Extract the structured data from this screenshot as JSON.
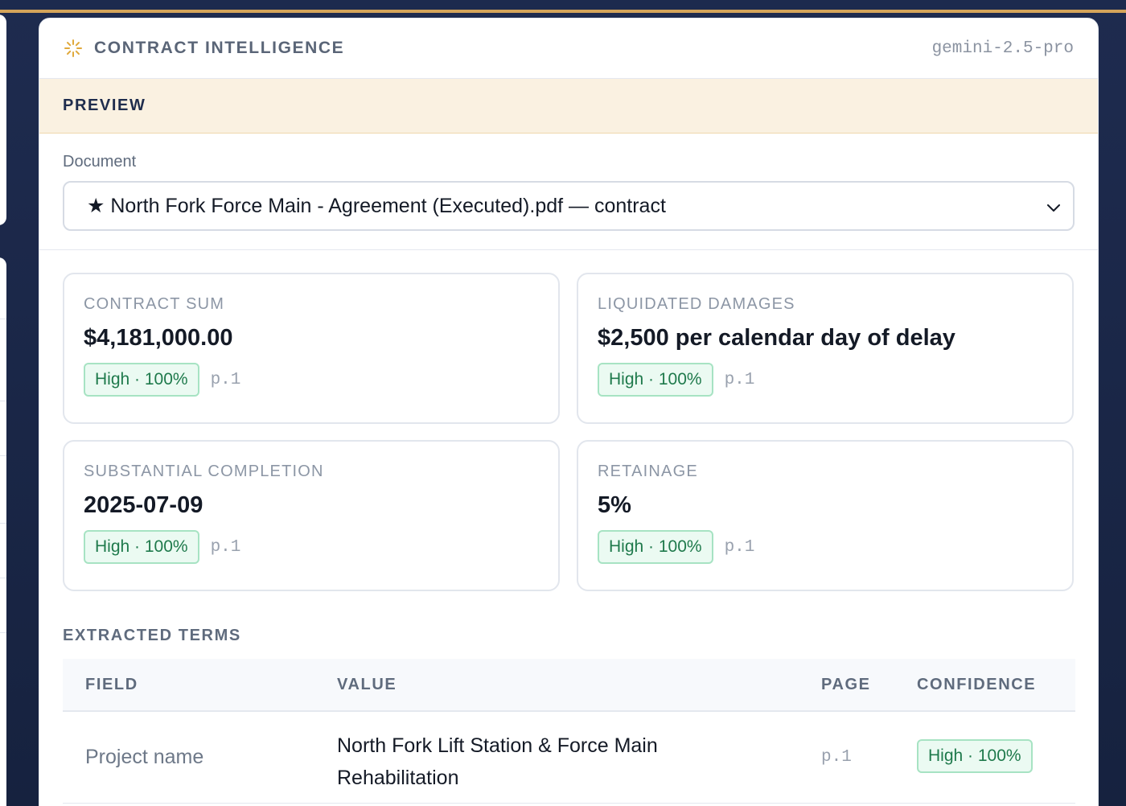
{
  "header": {
    "title": "CONTRACT INTELLIGENCE",
    "model": "gemini-2.5-pro"
  },
  "preview": {
    "label": "PREVIEW"
  },
  "document": {
    "label": "Document",
    "selected": "★ North Fork Force Main - Agreement (Executed).pdf — contract"
  },
  "metrics": [
    {
      "label": "CONTRACT SUM",
      "value": "$4,181,000.00",
      "confidence": "High · 100%",
      "page": "p.1"
    },
    {
      "label": "LIQUIDATED DAMAGES",
      "value": "$2,500 per calendar day of delay",
      "confidence": "High · 100%",
      "page": "p.1"
    },
    {
      "label": "SUBSTANTIAL COMPLETION",
      "value": "2025-07-09",
      "confidence": "High · 100%",
      "page": "p.1"
    },
    {
      "label": "RETAINAGE",
      "value": "5%",
      "confidence": "High · 100%",
      "page": "p.1"
    }
  ],
  "terms": {
    "title": "EXTRACTED TERMS",
    "columns": [
      "FIELD",
      "VALUE",
      "PAGE",
      "CONFIDENCE"
    ],
    "rows": [
      {
        "field": "Project name",
        "value": "North Fork Lift Station & Force Main Rehabilitation",
        "page": "p.1",
        "confidence": "High · 100%"
      }
    ]
  },
  "colors": {
    "accent": "#d4a45a",
    "navy": "#1f2d4d",
    "badge_green": "#1f7a4c",
    "preview_band": "#faf1e1"
  },
  "icons": {
    "brand": "sparkle-icon",
    "select": "chevron-down-icon"
  }
}
